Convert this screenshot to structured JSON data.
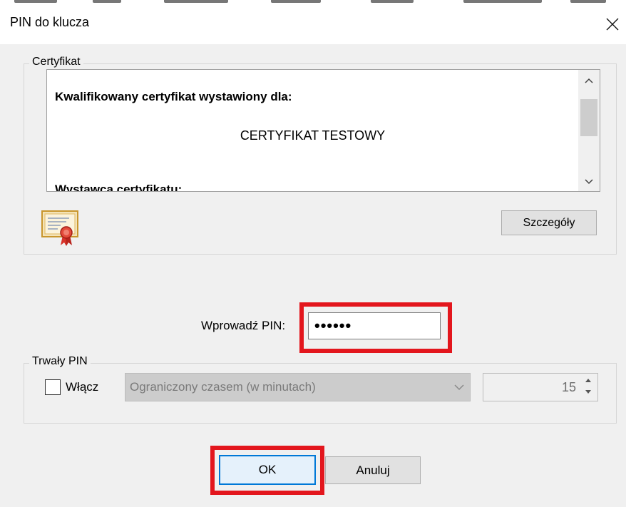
{
  "window": {
    "title": "PIN do klucza"
  },
  "certificate": {
    "group_label": "Certyfikat",
    "line1": "Kwalifikowany certyfikat wystawiony dla:",
    "line2": "CERTYFIKAT TESTOWY",
    "line3": "Wystawca certyfikatu:",
    "details_button": "Szczegóły",
    "icon": "certificate-icon"
  },
  "pin": {
    "label": "Wprowadź PIN:",
    "value": "••••••"
  },
  "persistent": {
    "group_label": "Trwały PIN",
    "enable_label": "Włącz",
    "enabled": false,
    "mode_selected": "Ograniczony czasem (w minutach)",
    "minutes_value": "15"
  },
  "buttons": {
    "ok": "OK",
    "cancel": "Anuluj"
  },
  "colors": {
    "highlight": "#e3161d",
    "ok_border": "#0078d7"
  }
}
